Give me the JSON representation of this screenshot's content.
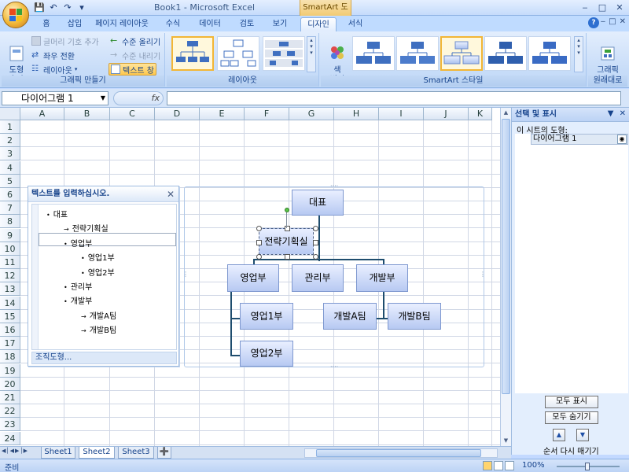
{
  "window": {
    "title": "Book1 - Microsoft Excel",
    "contextual_title": "SmartArt 도구"
  },
  "ribbon_tabs": [
    "홈",
    "삽입",
    "페이지 레이아웃",
    "수식",
    "데이터",
    "검토",
    "보기",
    "디자인",
    "서식"
  ],
  "active_tab": "디자인",
  "ribbon": {
    "create_graphic": {
      "group_label": "그래픽 만들기",
      "add_shape": "도형\n추가",
      "add_bullet": "글머리 기호 추가",
      "right_to_left": "좌우 전환",
      "layout": "레이아웃",
      "promote": "수준 올리기",
      "demote": "수준 내리기",
      "text_pane": "텍스트 창"
    },
    "layouts": {
      "group_label": "레이아웃"
    },
    "styles": {
      "group_label": "SmartArt 스타일",
      "change_colors": "색\n변경"
    },
    "reset": {
      "group_label": "원래대로",
      "reset_graphic": "그래픽\n원래대로"
    }
  },
  "formula_bar": {
    "name_box": "다이어그램 1",
    "fx": "fx"
  },
  "grid": {
    "columns": [
      "A",
      "B",
      "C",
      "D",
      "E",
      "F",
      "G",
      "H",
      "I",
      "J",
      "K"
    ],
    "rows": [
      "1",
      "2",
      "3",
      "4",
      "5",
      "6",
      "7",
      "8",
      "9",
      "10",
      "11",
      "12",
      "13",
      "14",
      "15",
      "16",
      "17",
      "18",
      "19",
      "20",
      "21",
      "22",
      "23",
      "24"
    ]
  },
  "text_pane": {
    "title": "텍스트를 입력하십시오.",
    "items": [
      {
        "text": "대표",
        "level": 1,
        "bullet": "•"
      },
      {
        "text": "전략기획실",
        "level": 2,
        "bullet": "→"
      },
      {
        "text": "영업부",
        "level": 2,
        "bullet": "•"
      },
      {
        "text": "영업1부",
        "level": 3,
        "bullet": "•"
      },
      {
        "text": "영업2부",
        "level": 3,
        "bullet": "•"
      },
      {
        "text": "관리부",
        "level": 2,
        "bullet": "•"
      },
      {
        "text": "개발부",
        "level": 2,
        "bullet": "•"
      },
      {
        "text": "개발A팀",
        "level": 3,
        "bullet": "→"
      },
      {
        "text": "개발B팀",
        "level": 3,
        "bullet": "→"
      }
    ],
    "footer": "조직도형..."
  },
  "org_chart": {
    "top": "대표",
    "assistant": "전략기획실",
    "level2": [
      "영업부",
      "관리부",
      "개발부"
    ],
    "sales_sub": [
      "영업1부",
      "영업2부"
    ],
    "dev_sub": [
      "개발A팀",
      "개발B팀"
    ]
  },
  "selection_pane": {
    "title": "선택 및 표시",
    "shapes_label": "이 시트의 도형:",
    "item": "다이어그램 1",
    "show_all": "모두 표시",
    "hide_all": "모두 숨기기",
    "reorder": "순서 다시 매기기"
  },
  "sheets": [
    "Sheet1",
    "Sheet2",
    "Sheet3"
  ],
  "active_sheet": "Sheet2",
  "status": {
    "ready": "준비",
    "zoom": "100%"
  }
}
